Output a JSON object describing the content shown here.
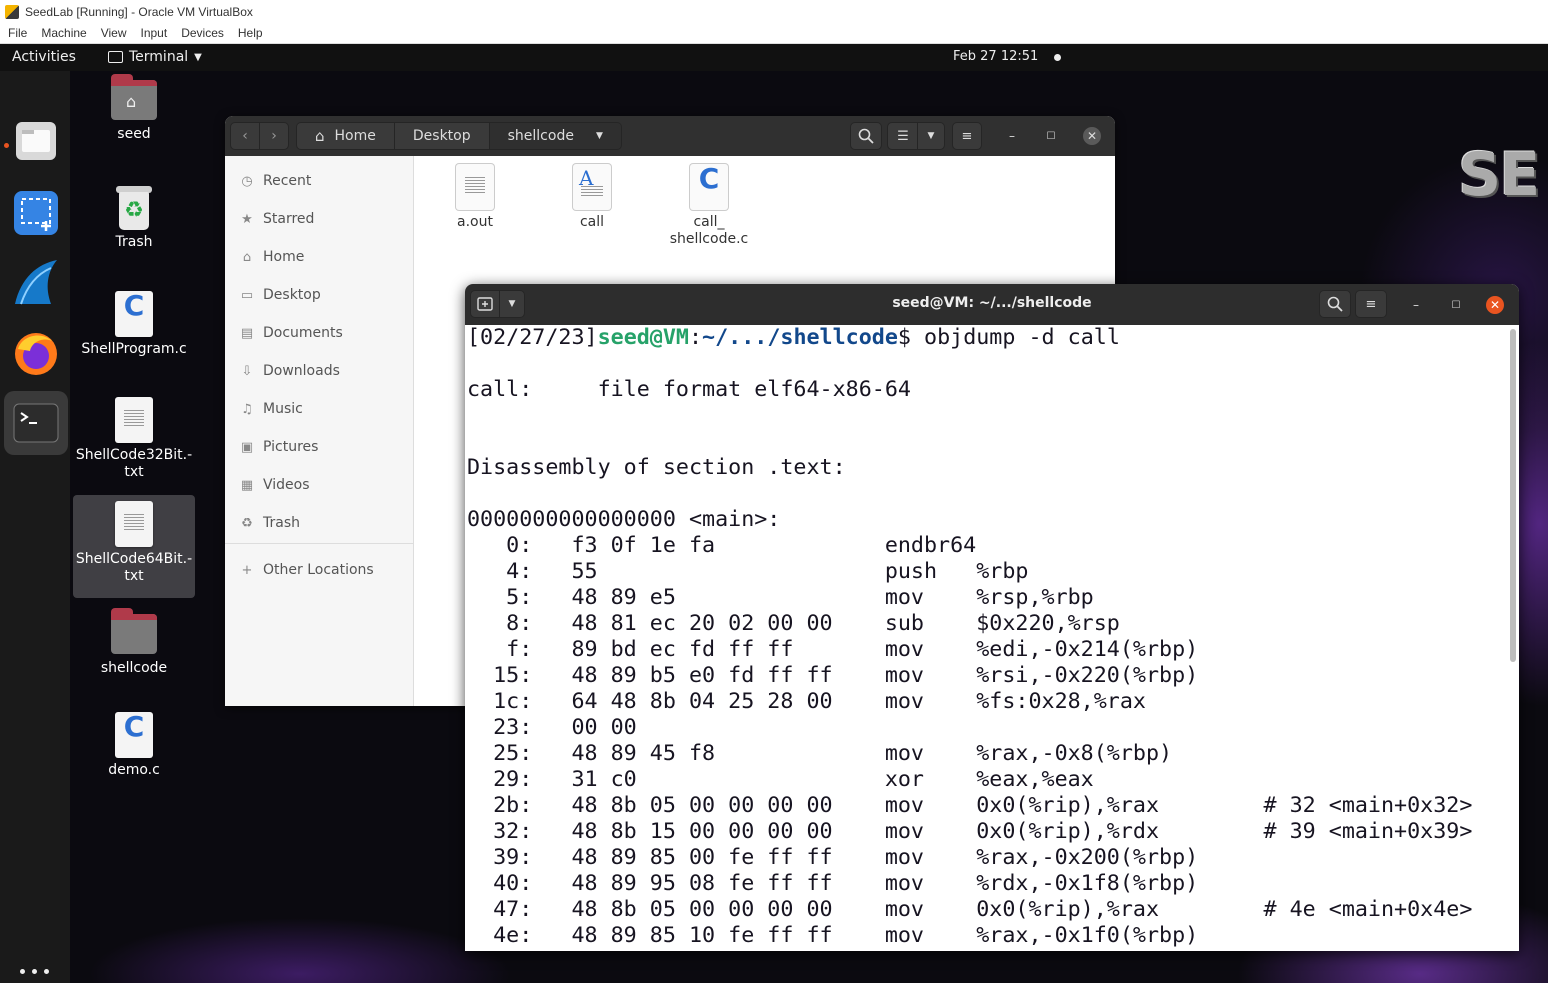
{
  "host": {
    "title": "SeedLab [Running] - Oracle VM VirtualBox",
    "menu": [
      "File",
      "Machine",
      "View",
      "Input",
      "Devices",
      "Help"
    ]
  },
  "topbar": {
    "activities": "Activities",
    "app_name": "Terminal",
    "clock": "Feb 27  12:51"
  },
  "dock": {
    "items": [
      "files-icon",
      "screenshot-icon",
      "wireshark-icon",
      "firefox-icon",
      "terminal-icon"
    ]
  },
  "desktop": {
    "icons": [
      {
        "label": "seed",
        "kind": "home-folder"
      },
      {
        "label": "Trash",
        "kind": "trash"
      },
      {
        "label": "ShellProgram.c",
        "kind": "c-file"
      },
      {
        "label": "ShellCode32Bit.-\ntxt",
        "kind": "text-file"
      },
      {
        "label": "ShellCode64Bit.-\ntxt",
        "kind": "text-file"
      },
      {
        "label": "shellcode",
        "kind": "folder"
      },
      {
        "label": "demo.c",
        "kind": "c-file"
      }
    ],
    "logo_text": "SE"
  },
  "file_manager": {
    "breadcrumbs": [
      "Home",
      "Desktop",
      "shellcode"
    ],
    "sidebar": [
      {
        "label": "Recent",
        "icon": "clock-icon"
      },
      {
        "label": "Starred",
        "icon": "star-icon"
      },
      {
        "label": "Home",
        "icon": "home-icon"
      },
      {
        "label": "Desktop",
        "icon": "desktop-icon"
      },
      {
        "label": "Documents",
        "icon": "document-icon"
      },
      {
        "label": "Downloads",
        "icon": "download-icon"
      },
      {
        "label": "Music",
        "icon": "music-icon"
      },
      {
        "label": "Pictures",
        "icon": "picture-icon"
      },
      {
        "label": "Videos",
        "icon": "video-icon"
      },
      {
        "label": "Trash",
        "icon": "trash-icon"
      },
      {
        "label": "Other Locations",
        "icon": "plus-icon"
      }
    ],
    "files": [
      {
        "name": "a.out",
        "kind": "binary"
      },
      {
        "name": "call",
        "kind": "text"
      },
      {
        "name": "call_\nshellcode.c",
        "kind": "c-file"
      }
    ]
  },
  "terminal": {
    "title": "seed@VM: ~/.../shellcode",
    "prompt": {
      "date": "[02/27/23]",
      "user_host": "seed@VM",
      "path": "~/.../shellcode",
      "command": "$ objdump -d call"
    },
    "lines": [
      "",
      "call:     file format elf64-x86-64",
      "",
      "",
      "Disassembly of section .text:",
      "",
      "0000000000000000 <main>:",
      "   0:   f3 0f 1e fa             endbr64",
      "   4:   55                      push   %rbp",
      "   5:   48 89 e5                mov    %rsp,%rbp",
      "   8:   48 81 ec 20 02 00 00    sub    $0x220,%rsp",
      "   f:   89 bd ec fd ff ff       mov    %edi,-0x214(%rbp)",
      "  15:   48 89 b5 e0 fd ff ff    mov    %rsi,-0x220(%rbp)",
      "  1c:   64 48 8b 04 25 28 00    mov    %fs:0x28,%rax",
      "  23:   00 00",
      "  25:   48 89 45 f8             mov    %rax,-0x8(%rbp)",
      "  29:   31 c0                   xor    %eax,%eax",
      "  2b:   48 8b 05 00 00 00 00    mov    0x0(%rip),%rax        # 32 <main+0x32>",
      "  32:   48 8b 15 00 00 00 00    mov    0x0(%rip),%rdx        # 39 <main+0x39>",
      "  39:   48 89 85 00 fe ff ff    mov    %rax,-0x200(%rbp)",
      "  40:   48 89 95 08 fe ff ff    mov    %rdx,-0x1f8(%rbp)",
      "  47:   48 8b 05 00 00 00 00    mov    0x0(%rip),%rax        # 4e <main+0x4e>",
      "  4e:   48 89 85 10 fe ff ff    mov    %rax,-0x1f0(%rbp)"
    ]
  }
}
